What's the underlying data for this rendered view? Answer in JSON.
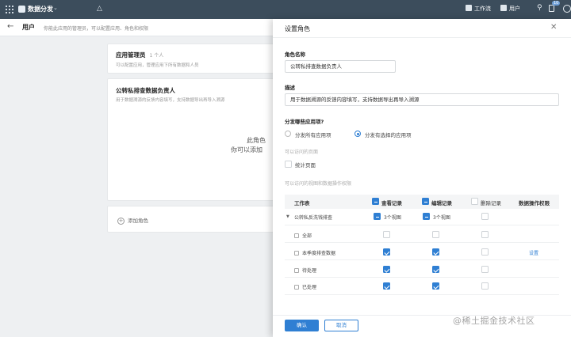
{
  "topbar": {
    "app_name": "数据分发",
    "workflow_label": "工作流",
    "users_label": "用户",
    "badge": "10"
  },
  "pagebar": {
    "title": "用户",
    "description": "你能此应用的管理员，可以配置应用、角色和权限"
  },
  "roles": [
    {
      "name": "应用管理员",
      "count": "1 个人",
      "desc": "可以配置应用，管理应用下所有数据和人员"
    },
    {
      "name": "公转私排查数据负责人",
      "desc": "用于数据溯源的反馈内容填写，支持数据导出再导入溯源"
    }
  ],
  "empty": {
    "line1": "此角色",
    "line2": "你可以添加"
  },
  "add_role_label": "添加角色",
  "drawer": {
    "title": "设置角色",
    "role_name_label": "角色名称",
    "role_name_value": "公转私排查数据负责人",
    "desc_label": "描述",
    "desc_value": "用于数据溯源的反馈内容填写，支持数据导出再导入溯源",
    "dist_label": "分发哪些应用项?",
    "radio_all": "分发所有应用项",
    "radio_selected": "分发有选择的应用项",
    "radio_selected_on": true,
    "pages_label": "可以访问的页面",
    "page_option": "统计页面",
    "perm_label": "可以访问的视图和数据操作权限",
    "columns": {
      "sheet": "工作表",
      "view": "查看记录",
      "edit": "编辑记录",
      "delete": "删除记录",
      "ops": "数据操作权限"
    },
    "table_row": {
      "name": "公转私反洗钱排查",
      "view_fields": "3个视图",
      "edit_fields": "3个视图",
      "ops_link": "设置"
    },
    "views": [
      {
        "name": "全部",
        "view": false,
        "edit": false,
        "delete": false
      },
      {
        "name": "本季度排查数据",
        "view": true,
        "edit": true,
        "delete": false
      },
      {
        "name": "待处理",
        "view": true,
        "edit": true,
        "delete": false
      },
      {
        "name": "已处理",
        "view": true,
        "edit": true,
        "delete": false
      }
    ],
    "confirm_label": "确认",
    "cancel_label": "取消"
  },
  "watermark": "@稀土掘金技术社区",
  "accent": "#2f7fd3",
  "topbar_color": "#3c4d5c"
}
